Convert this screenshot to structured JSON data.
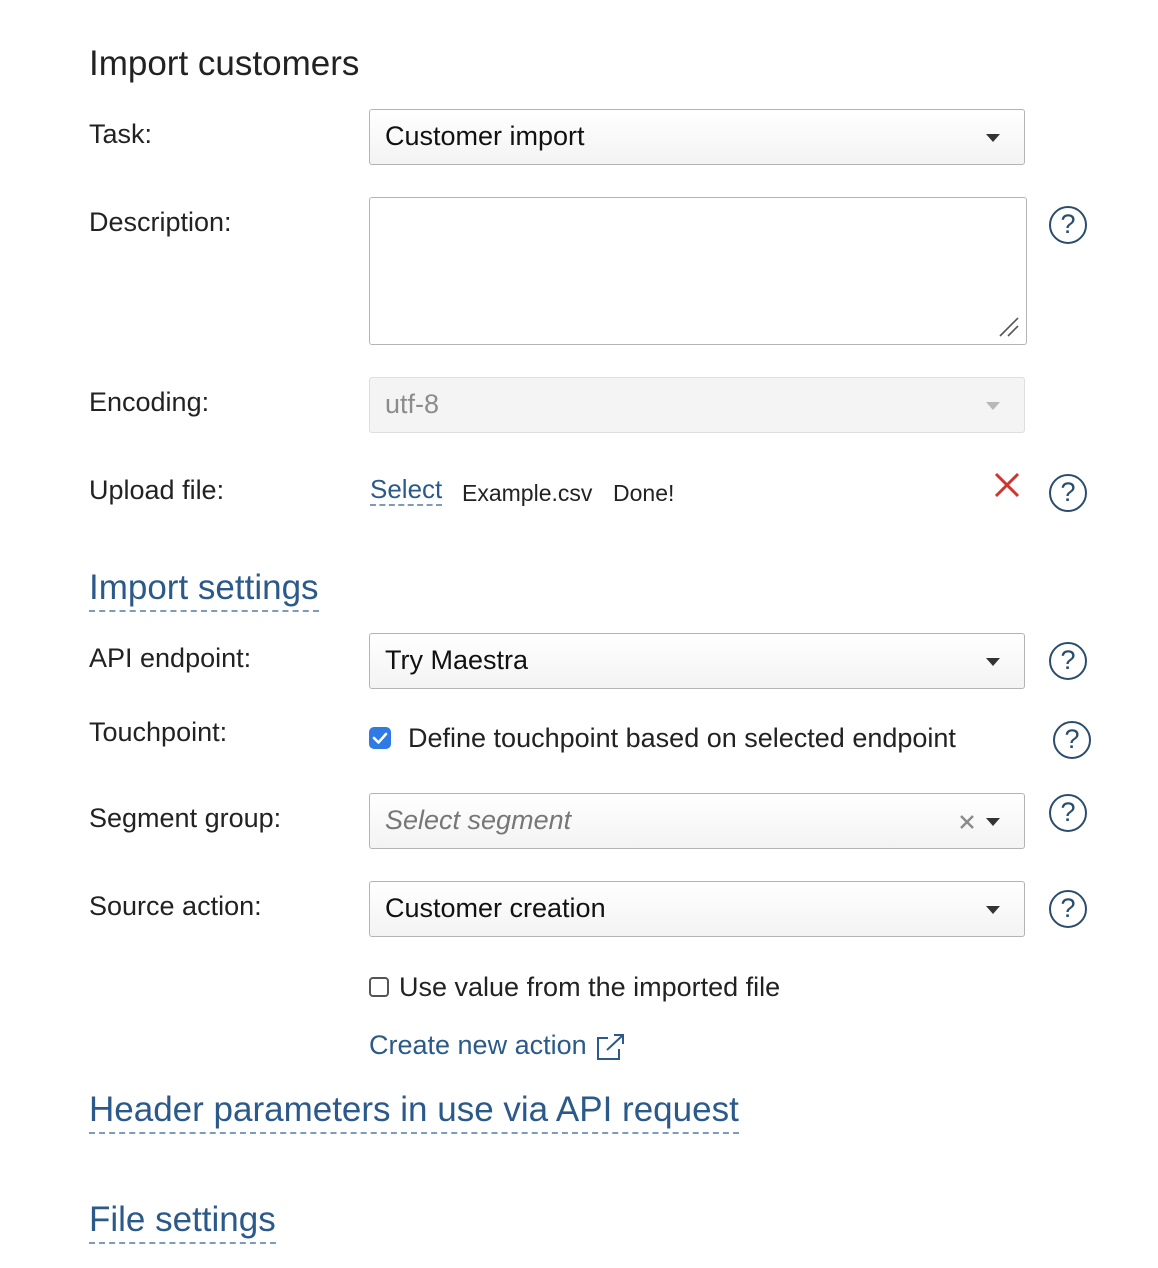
{
  "page": {
    "title": "Import customers"
  },
  "fields": {
    "task": {
      "label": "Task:",
      "value": "Customer import"
    },
    "description": {
      "label": "Description:",
      "value": ""
    },
    "encoding": {
      "label": "Encoding:",
      "value": "utf-8"
    },
    "upload": {
      "label": "Upload file:",
      "select_link": "Select",
      "file_name": "Example.csv",
      "status": "Done!"
    }
  },
  "sections": {
    "import_settings": "Import settings",
    "header_parameters": "Header parameters in use via API request",
    "file_settings": "File settings"
  },
  "import_settings": {
    "api_endpoint": {
      "label": "API endpoint:",
      "value": "Try Maestra"
    },
    "touchpoint": {
      "label": "Touchpoint:",
      "checkbox_label": "Define touchpoint based on selected endpoint",
      "checked": true
    },
    "segment_group": {
      "label": "Segment group:",
      "placeholder": "Select segment"
    },
    "source_action": {
      "label": "Source action:",
      "value": "Customer creation",
      "use_file_value_label": "Use value from the imported file",
      "use_file_value_checked": false,
      "create_new_action_link": "Create new action"
    }
  },
  "icons": {
    "help": "question-circle-icon",
    "remove": "close-icon",
    "external": "external-link-icon",
    "dropdown": "caret-down-icon",
    "clear": "clear-icon"
  },
  "help_glyph": "?",
  "colors": {
    "link": "#2b5a8a",
    "help_circle": "#2a4d6e",
    "remove_x": "#d0342c",
    "checkbox_checked": "#2f7ae5"
  }
}
